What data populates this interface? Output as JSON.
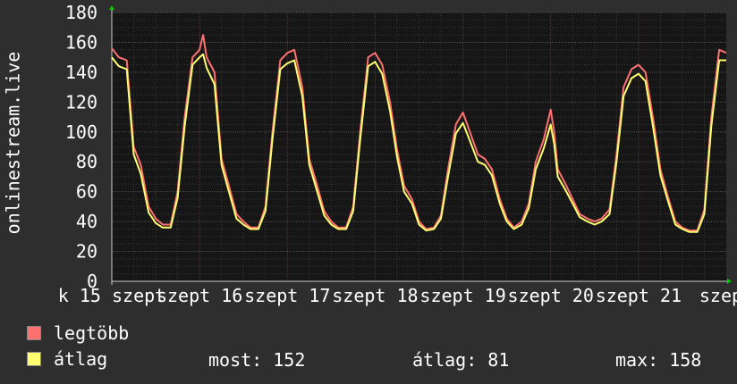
{
  "chart_data": {
    "type": "line",
    "ylabel": "onlinestream.live",
    "ylim": [
      0,
      180
    ],
    "yticks": [
      0,
      20,
      40,
      60,
      80,
      100,
      120,
      140,
      160,
      180
    ],
    "grid": true,
    "x_range_days": [
      15,
      22
    ],
    "x_tick_labels": [
      "k 15 szept",
      "szept 16",
      "szept 17",
      "szept 18",
      "szept 19",
      "szept 20",
      "szept 21",
      "szept"
    ],
    "series": [
      {
        "name": "legtöbb",
        "color": "#ff7070",
        "points": [
          [
            15.0,
            156
          ],
          [
            15.08,
            150
          ],
          [
            15.17,
            148
          ],
          [
            15.25,
            90
          ],
          [
            15.33,
            78
          ],
          [
            15.42,
            50
          ],
          [
            15.5,
            42
          ],
          [
            15.58,
            38
          ],
          [
            15.67,
            38
          ],
          [
            15.75,
            60
          ],
          [
            15.83,
            110
          ],
          [
            15.92,
            150
          ],
          [
            16.0,
            155
          ],
          [
            16.04,
            165
          ],
          [
            16.08,
            150
          ],
          [
            16.17,
            140
          ],
          [
            16.25,
            82
          ],
          [
            16.33,
            65
          ],
          [
            16.42,
            45
          ],
          [
            16.5,
            40
          ],
          [
            16.58,
            36
          ],
          [
            16.67,
            36
          ],
          [
            16.75,
            50
          ],
          [
            16.83,
            100
          ],
          [
            16.92,
            148
          ],
          [
            17.0,
            153
          ],
          [
            17.08,
            155
          ],
          [
            17.17,
            130
          ],
          [
            17.25,
            82
          ],
          [
            17.33,
            66
          ],
          [
            17.42,
            47
          ],
          [
            17.5,
            40
          ],
          [
            17.58,
            36
          ],
          [
            17.67,
            36
          ],
          [
            17.75,
            50
          ],
          [
            17.83,
            100
          ],
          [
            17.92,
            150
          ],
          [
            18.0,
            153
          ],
          [
            18.08,
            145
          ],
          [
            18.17,
            120
          ],
          [
            18.25,
            88
          ],
          [
            18.33,
            64
          ],
          [
            18.42,
            55
          ],
          [
            18.5,
            40
          ],
          [
            18.58,
            35
          ],
          [
            18.67,
            36
          ],
          [
            18.75,
            44
          ],
          [
            18.83,
            75
          ],
          [
            18.92,
            105
          ],
          [
            19.0,
            113
          ],
          [
            19.08,
            100
          ],
          [
            19.17,
            85
          ],
          [
            19.25,
            82
          ],
          [
            19.33,
            75
          ],
          [
            19.42,
            55
          ],
          [
            19.5,
            42
          ],
          [
            19.58,
            36
          ],
          [
            19.67,
            40
          ],
          [
            19.75,
            52
          ],
          [
            19.83,
            80
          ],
          [
            19.92,
            95
          ],
          [
            20.0,
            115
          ],
          [
            20.04,
            100
          ],
          [
            20.08,
            75
          ],
          [
            20.17,
            65
          ],
          [
            20.25,
            55
          ],
          [
            20.33,
            45
          ],
          [
            20.42,
            42
          ],
          [
            20.5,
            40
          ],
          [
            20.58,
            42
          ],
          [
            20.67,
            48
          ],
          [
            20.75,
            85
          ],
          [
            20.83,
            130
          ],
          [
            20.92,
            142
          ],
          [
            21.0,
            145
          ],
          [
            21.08,
            140
          ],
          [
            21.17,
            108
          ],
          [
            21.25,
            75
          ],
          [
            21.33,
            58
          ],
          [
            21.42,
            40
          ],
          [
            21.5,
            36
          ],
          [
            21.58,
            34
          ],
          [
            21.67,
            34
          ],
          [
            21.75,
            48
          ],
          [
            21.83,
            110
          ],
          [
            21.92,
            155
          ],
          [
            22.0,
            153
          ]
        ]
      },
      {
        "name": "átlag",
        "color": "#ffff70",
        "points": [
          [
            15.0,
            150
          ],
          [
            15.08,
            144
          ],
          [
            15.17,
            142
          ],
          [
            15.25,
            85
          ],
          [
            15.33,
            72
          ],
          [
            15.42,
            46
          ],
          [
            15.5,
            39
          ],
          [
            15.58,
            36
          ],
          [
            15.67,
            36
          ],
          [
            15.75,
            56
          ],
          [
            15.83,
            104
          ],
          [
            15.92,
            145
          ],
          [
            16.0,
            150
          ],
          [
            16.04,
            152
          ],
          [
            16.08,
            143
          ],
          [
            16.17,
            132
          ],
          [
            16.25,
            78
          ],
          [
            16.33,
            61
          ],
          [
            16.42,
            42
          ],
          [
            16.5,
            38
          ],
          [
            16.58,
            35
          ],
          [
            16.67,
            35
          ],
          [
            16.75,
            47
          ],
          [
            16.83,
            95
          ],
          [
            16.92,
            142
          ],
          [
            17.0,
            146
          ],
          [
            17.08,
            148
          ],
          [
            17.17,
            124
          ],
          [
            17.25,
            78
          ],
          [
            17.33,
            62
          ],
          [
            17.42,
            44
          ],
          [
            17.5,
            38
          ],
          [
            17.58,
            35
          ],
          [
            17.67,
            35
          ],
          [
            17.75,
            47
          ],
          [
            17.83,
            95
          ],
          [
            17.92,
            144
          ],
          [
            18.0,
            147
          ],
          [
            18.08,
            139
          ],
          [
            18.17,
            114
          ],
          [
            18.25,
            83
          ],
          [
            18.33,
            60
          ],
          [
            18.42,
            52
          ],
          [
            18.5,
            38
          ],
          [
            18.58,
            34
          ],
          [
            18.67,
            35
          ],
          [
            18.75,
            42
          ],
          [
            18.83,
            70
          ],
          [
            18.92,
            99
          ],
          [
            19.0,
            106
          ],
          [
            19.08,
            94
          ],
          [
            19.17,
            80
          ],
          [
            19.25,
            78
          ],
          [
            19.33,
            71
          ],
          [
            19.42,
            52
          ],
          [
            19.5,
            40
          ],
          [
            19.58,
            35
          ],
          [
            19.67,
            38
          ],
          [
            19.75,
            49
          ],
          [
            19.83,
            75
          ],
          [
            19.92,
            89
          ],
          [
            20.0,
            105
          ],
          [
            20.04,
            92
          ],
          [
            20.08,
            70
          ],
          [
            20.17,
            61
          ],
          [
            20.25,
            52
          ],
          [
            20.33,
            43
          ],
          [
            20.42,
            40
          ],
          [
            20.5,
            38
          ],
          [
            20.58,
            40
          ],
          [
            20.67,
            45
          ],
          [
            20.75,
            80
          ],
          [
            20.83,
            124
          ],
          [
            20.92,
            136
          ],
          [
            21.0,
            139
          ],
          [
            21.08,
            134
          ],
          [
            21.17,
            102
          ],
          [
            21.25,
            71
          ],
          [
            21.33,
            55
          ],
          [
            21.42,
            38
          ],
          [
            21.5,
            35
          ],
          [
            21.58,
            33
          ],
          [
            21.67,
            33
          ],
          [
            21.75,
            45
          ],
          [
            21.83,
            104
          ],
          [
            21.92,
            148
          ],
          [
            22.0,
            148
          ]
        ]
      }
    ]
  },
  "legend": [
    {
      "label": "legtöbb",
      "color": "#ff7070"
    },
    {
      "label": "átlag",
      "color": "#ffff70"
    }
  ],
  "stats": {
    "most": "most: 152",
    "atlag": "átlag: 81",
    "max": "max: 158"
  }
}
